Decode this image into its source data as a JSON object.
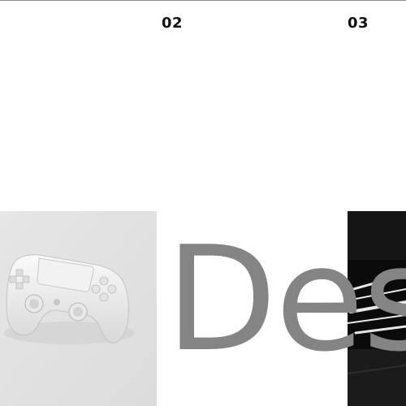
{
  "slides": {
    "second_number": "02",
    "third_number": "03"
  },
  "hero": {
    "word": "Des"
  },
  "images": {
    "controller": "game-controller-image",
    "road": "night-road-image"
  }
}
